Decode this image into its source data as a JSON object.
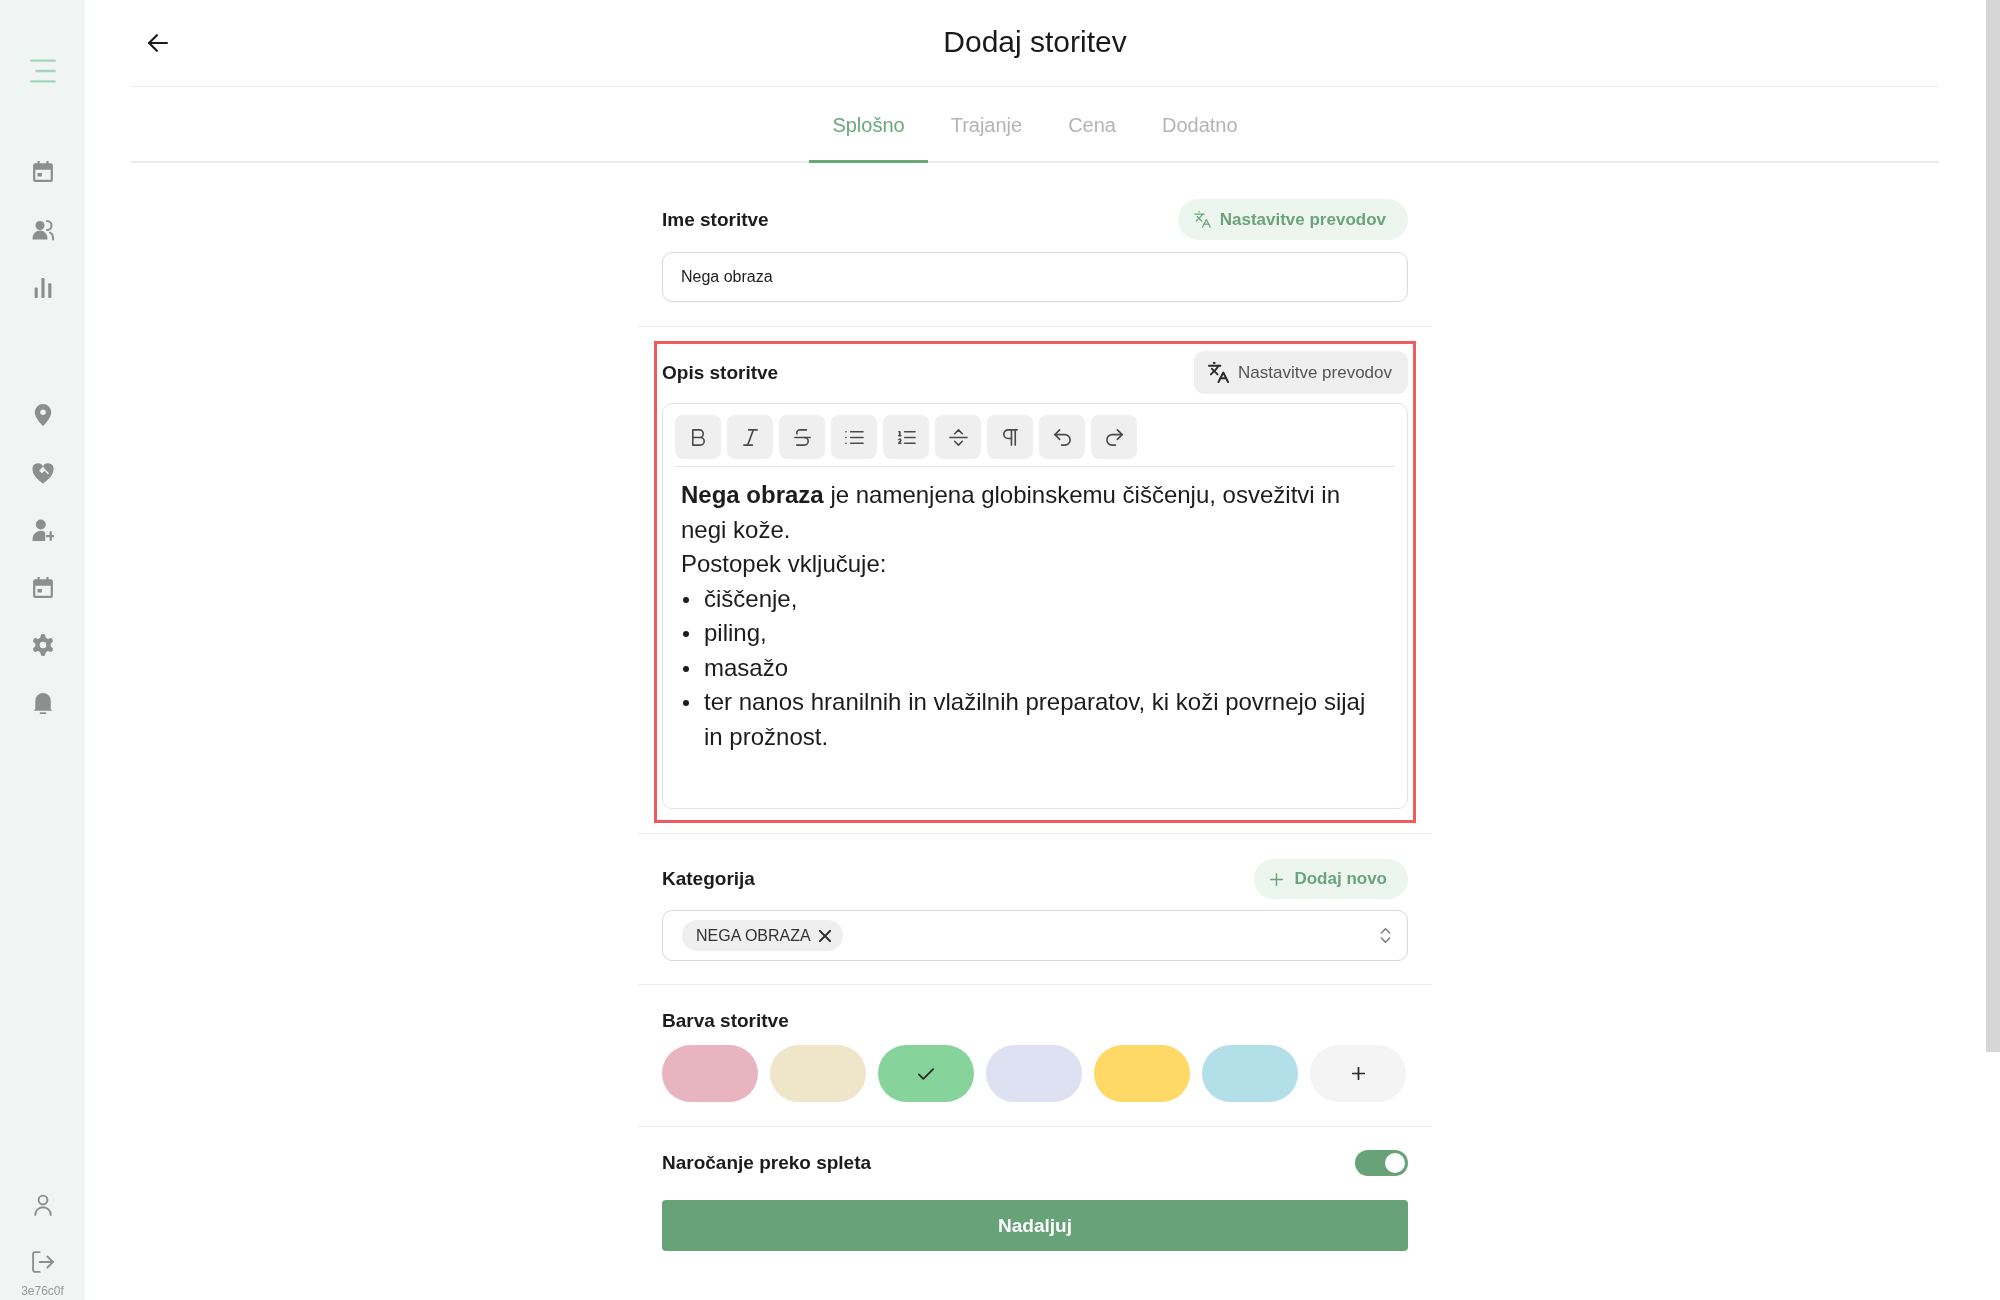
{
  "sidebar": {
    "version": "3e76c0f"
  },
  "header": {
    "title": "Dodaj storitev"
  },
  "tabs": [
    {
      "label": "Splošno",
      "selected": true
    },
    {
      "label": "Trajanje",
      "selected": false
    },
    {
      "label": "Cena",
      "selected": false
    },
    {
      "label": "Dodatno",
      "selected": false
    }
  ],
  "name_field": {
    "label": "Ime storitve",
    "translate_button": {
      "label": "Nastavitve prevodov",
      "kind": "accent"
    },
    "value": "Nega obraza"
  },
  "description": {
    "label": "Opis storitve",
    "highlighted": true,
    "translate_button": {
      "label": "Nastavitve prevodov",
      "kind": "neutral"
    },
    "paragraphs": [
      "**Nega obraza** je namenjena globinskemu čiščenju, osvežitvi in negi kože.",
      "Postopek vključuje:"
    ],
    "bullets": [
      "čiščenje,",
      "piling,",
      "masažo",
      "ter nanos hranilnih in vlažilnih preparatov, ki koži povrnejo sijaj in prožnost."
    ]
  },
  "category": {
    "label": "Kategorija",
    "add_button": "Dodaj novo",
    "tags": [
      "NEGA OBRAZA"
    ]
  },
  "color": {
    "label": "Barva storitve",
    "swatches": [
      {
        "color": "#e8b4bf",
        "selected": false
      },
      {
        "color": "#efe6c9",
        "selected": false
      },
      {
        "color": "#86d39b",
        "selected": true
      },
      {
        "color": "#dde1f1",
        "selected": false
      },
      {
        "color": "#ffd966",
        "selected": false
      },
      {
        "color": "#b3dfe9",
        "selected": false
      }
    ]
  },
  "online_booking": {
    "label": "Naročanje preko spleta",
    "on": true
  },
  "submit_button": "Nadaljuj"
}
